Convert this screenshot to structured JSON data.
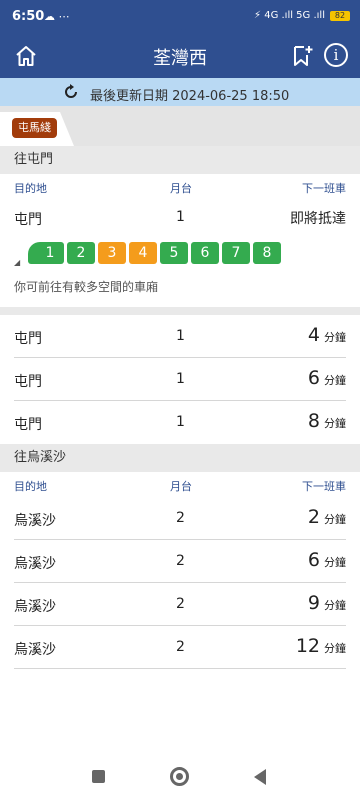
{
  "status": {
    "time": "6:50",
    "icons": "☁ ⋯",
    "right_icons": "⚡ 4G .ıll 5G .ıll",
    "battery": "82"
  },
  "header": {
    "title": "荃灣西"
  },
  "update": {
    "text": "最後更新日期 2024-06-25 18:50"
  },
  "line_tab": {
    "label": "屯馬綫",
    "color": "#a23c0b"
  },
  "columns": {
    "destination": "目的地",
    "platform": "月台",
    "next": "下一班車"
  },
  "sections": [
    {
      "title": "往屯門",
      "first": {
        "dest": "屯門",
        "platform": "1",
        "eta_text": "即將抵達"
      },
      "cars": [
        {
          "label": "1",
          "state": "green"
        },
        {
          "label": "2",
          "state": "green"
        },
        {
          "label": "3",
          "state": "orange"
        },
        {
          "label": "4",
          "state": "orange"
        },
        {
          "label": "5",
          "state": "green"
        },
        {
          "label": "6",
          "state": "green"
        },
        {
          "label": "7",
          "state": "green"
        },
        {
          "label": "8",
          "state": "green"
        }
      ],
      "hint": "你可前往有較多空間的車廂",
      "rows": [
        {
          "dest": "屯門",
          "platform": "1",
          "eta": "4",
          "unit": "分鐘"
        },
        {
          "dest": "屯門",
          "platform": "1",
          "eta": "6",
          "unit": "分鐘"
        },
        {
          "dest": "屯門",
          "platform": "1",
          "eta": "8",
          "unit": "分鐘"
        }
      ]
    },
    {
      "title": "往烏溪沙",
      "rows": [
        {
          "dest": "烏溪沙",
          "platform": "2",
          "eta": "2",
          "unit": "分鐘"
        },
        {
          "dest": "烏溪沙",
          "platform": "2",
          "eta": "6",
          "unit": "分鐘"
        },
        {
          "dest": "烏溪沙",
          "platform": "2",
          "eta": "9",
          "unit": "分鐘"
        },
        {
          "dest": "烏溪沙",
          "platform": "2",
          "eta": "12",
          "unit": "分鐘"
        }
      ]
    }
  ],
  "colors": {
    "header": "#2f4f90",
    "update_bar": "#b9d9f3",
    "car_green": "#34ab4f",
    "car_orange": "#f49c1c"
  }
}
